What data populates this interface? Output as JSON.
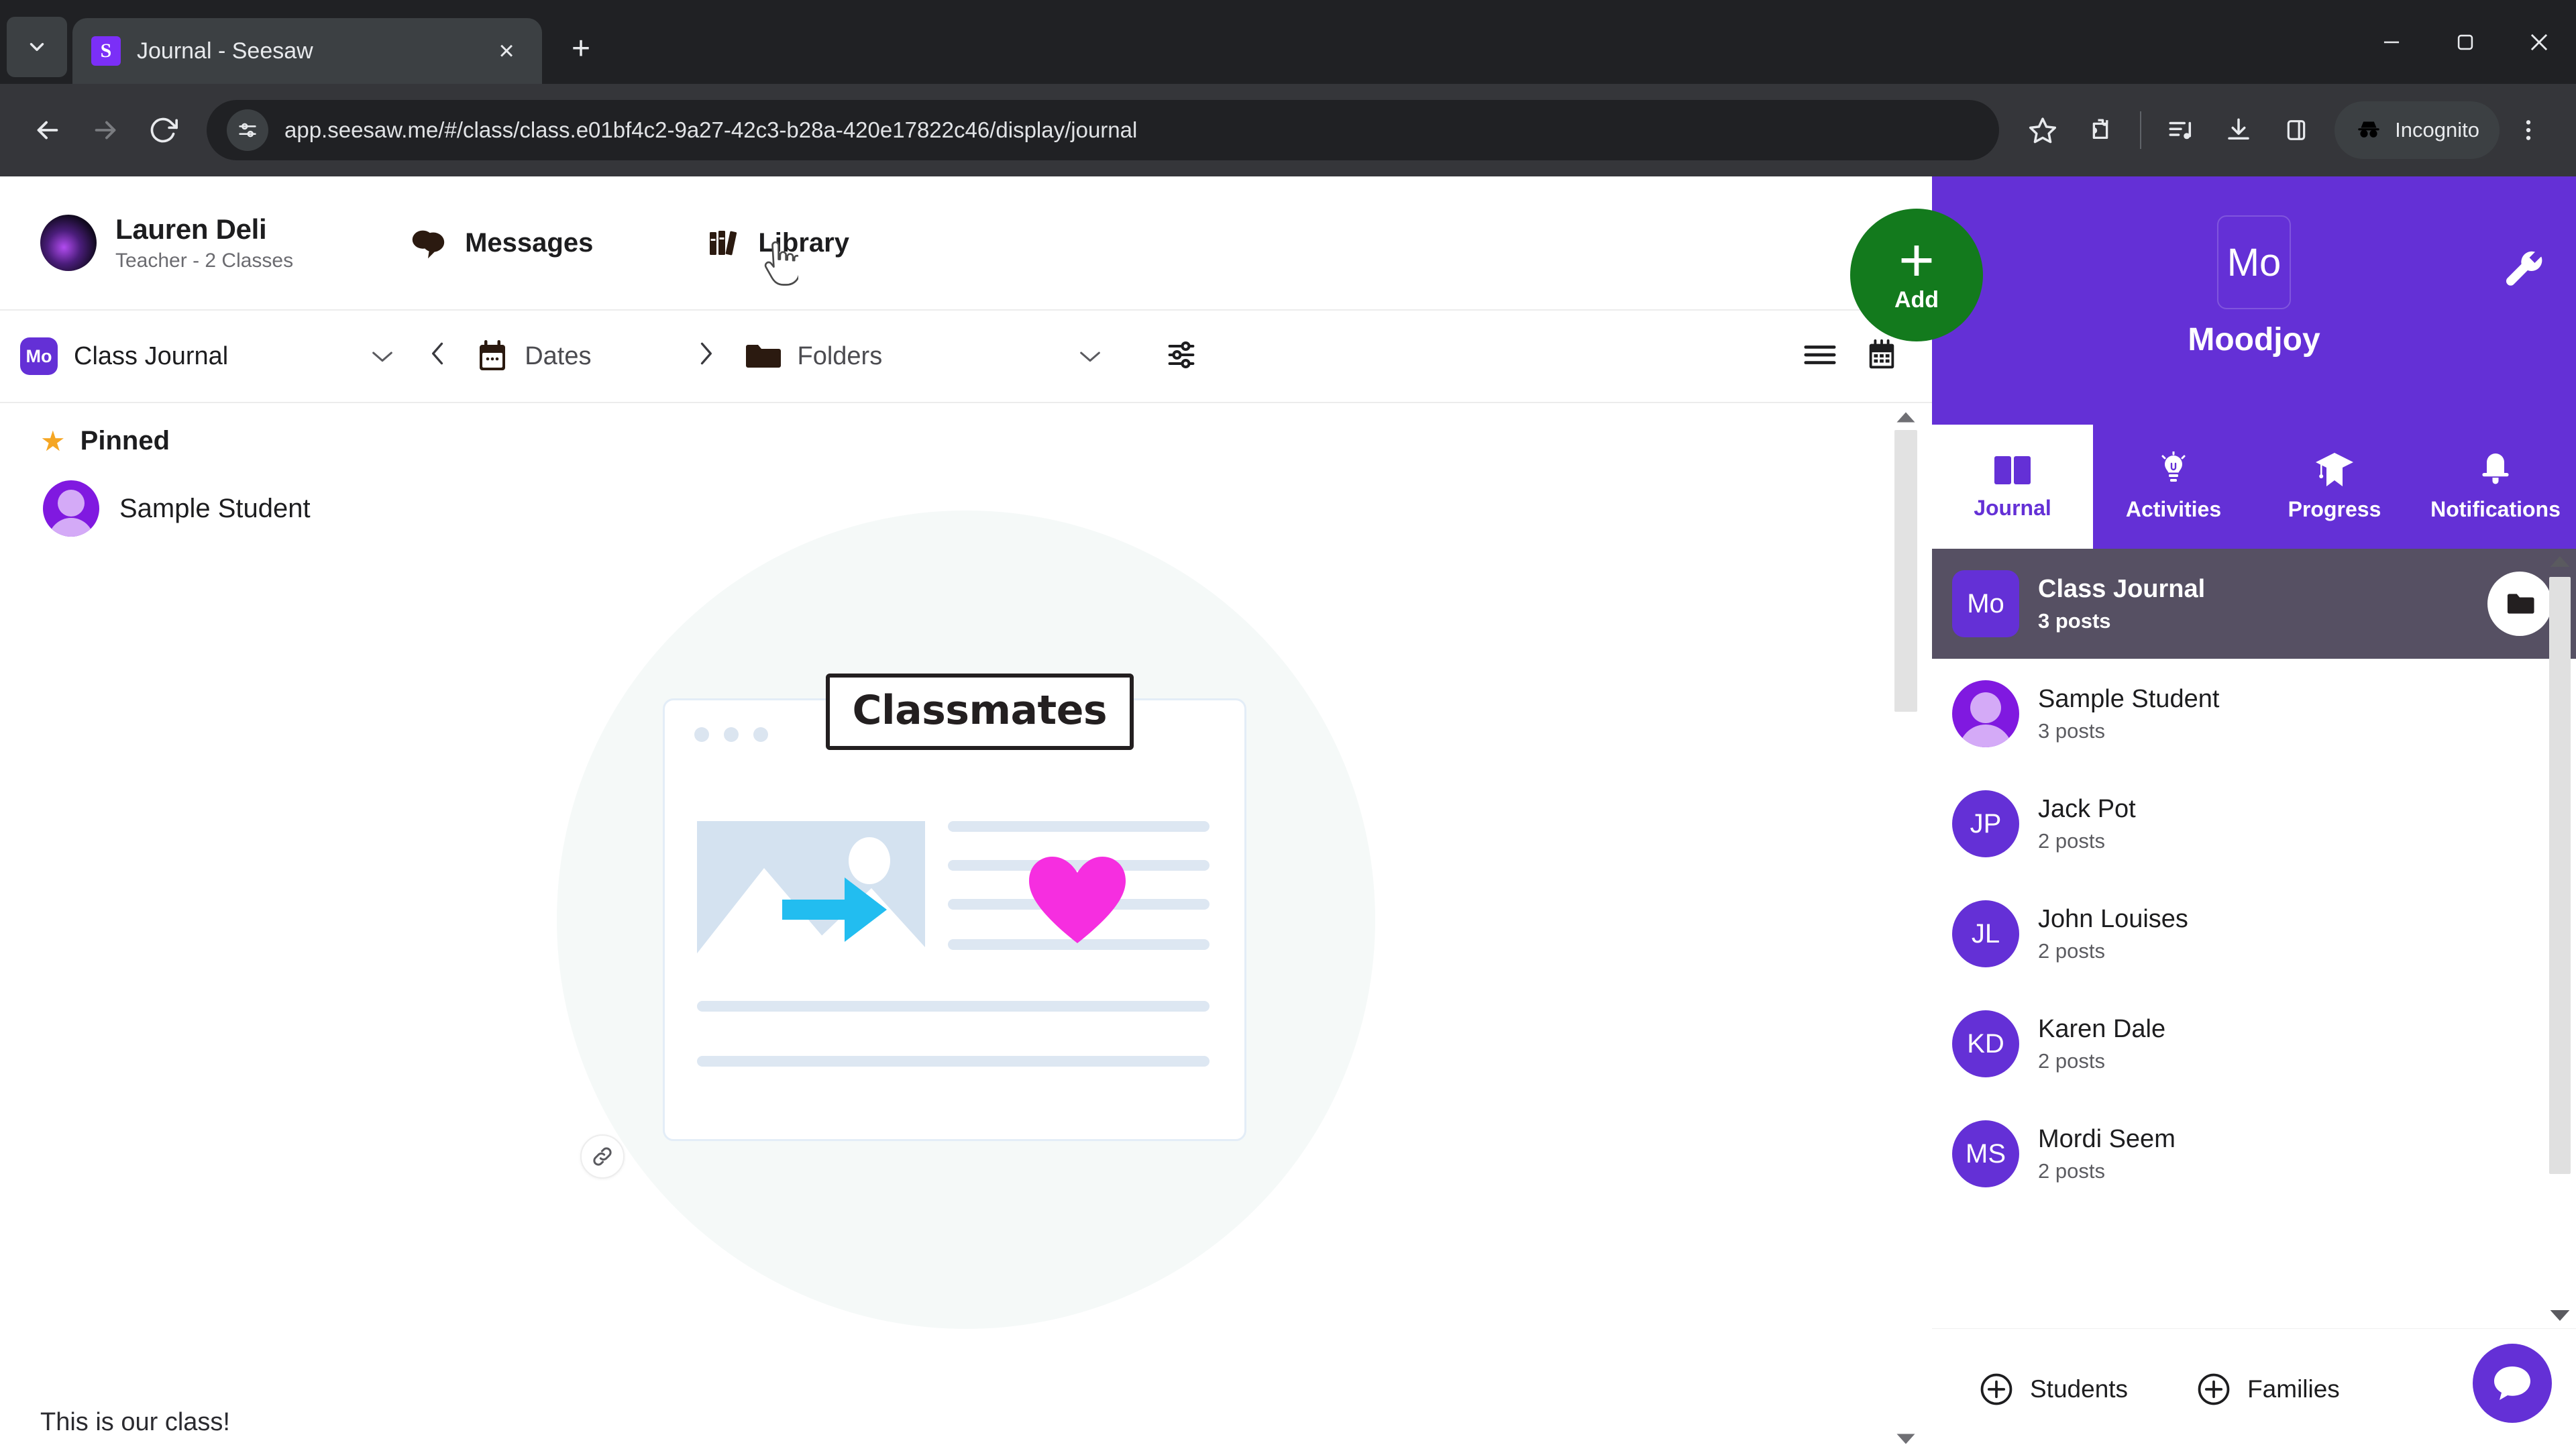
{
  "browser": {
    "tab": {
      "title": "Journal - Seesaw",
      "favicon_letter": "S"
    },
    "new_tab_label": "+",
    "close_label": "×",
    "nav": {
      "back": "←",
      "forward": "→",
      "reload": "⟳"
    },
    "url": "app.seesaw.me/#/class/class.e01bf4c2-9a27-42c3-b28a-420e17822c46/display/journal",
    "profile_label": "Incognito",
    "window": {
      "minimize": "—",
      "maximize": "❐",
      "close": "✕"
    },
    "accent": "#7b2ff7"
  },
  "app_header": {
    "user_name": "Lauren Deli",
    "user_role": "Teacher - 2 Classes",
    "messages_label": "Messages",
    "library_label": "Library"
  },
  "subbar": {
    "class_badge": "Mo",
    "class_label": "Class Journal",
    "class_caret": "⌄",
    "prev_arrow": "‹",
    "dates_label": "Dates",
    "next_arrow": "›",
    "folders_label": "Folders",
    "folders_caret": "⌄"
  },
  "feed": {
    "pinned_label": "Pinned",
    "pinned_star": "★",
    "student_name": "Sample Student",
    "illustration_label": "Classmates",
    "caption": "This is our class!",
    "colors": {
      "arrow": "#22bdf0",
      "heart": "#f62ee0",
      "photo_bg": "#d4e2f0"
    }
  },
  "rail": {
    "class_initials": "Mo",
    "class_name": "Moodjoy",
    "add_label": "Add",
    "add_plus": "+",
    "tabs": [
      {
        "label": "Journal",
        "icon": "book-icon",
        "active": true
      },
      {
        "label": "Activities",
        "icon": "lightbulb-icon",
        "active": false
      },
      {
        "label": "Progress",
        "icon": "graduation-cap-icon",
        "active": false
      },
      {
        "label": "Notifications",
        "icon": "bell-icon",
        "active": false
      }
    ],
    "items": [
      {
        "initials": "Mo",
        "name": "Class Journal",
        "posts": "3 posts",
        "type": "class",
        "selected": true
      },
      {
        "initials": "",
        "name": "Sample Student",
        "posts": "3 posts",
        "type": "person",
        "selected": false
      },
      {
        "initials": "JP",
        "name": "Jack Pot",
        "posts": "2 posts",
        "type": "initials",
        "selected": false
      },
      {
        "initials": "JL",
        "name": "John Louises",
        "posts": "2 posts",
        "type": "initials",
        "selected": false
      },
      {
        "initials": "KD",
        "name": "Karen Dale",
        "posts": "2 posts",
        "type": "initials",
        "selected": false
      },
      {
        "initials": "MS",
        "name": "Mordi Seem",
        "posts": "2 posts",
        "type": "initials",
        "selected": false
      }
    ],
    "bottom": {
      "students_label": "Students",
      "families_label": "Families",
      "plus": "+"
    },
    "purple": "#6430d6",
    "green": "#137a1d"
  }
}
